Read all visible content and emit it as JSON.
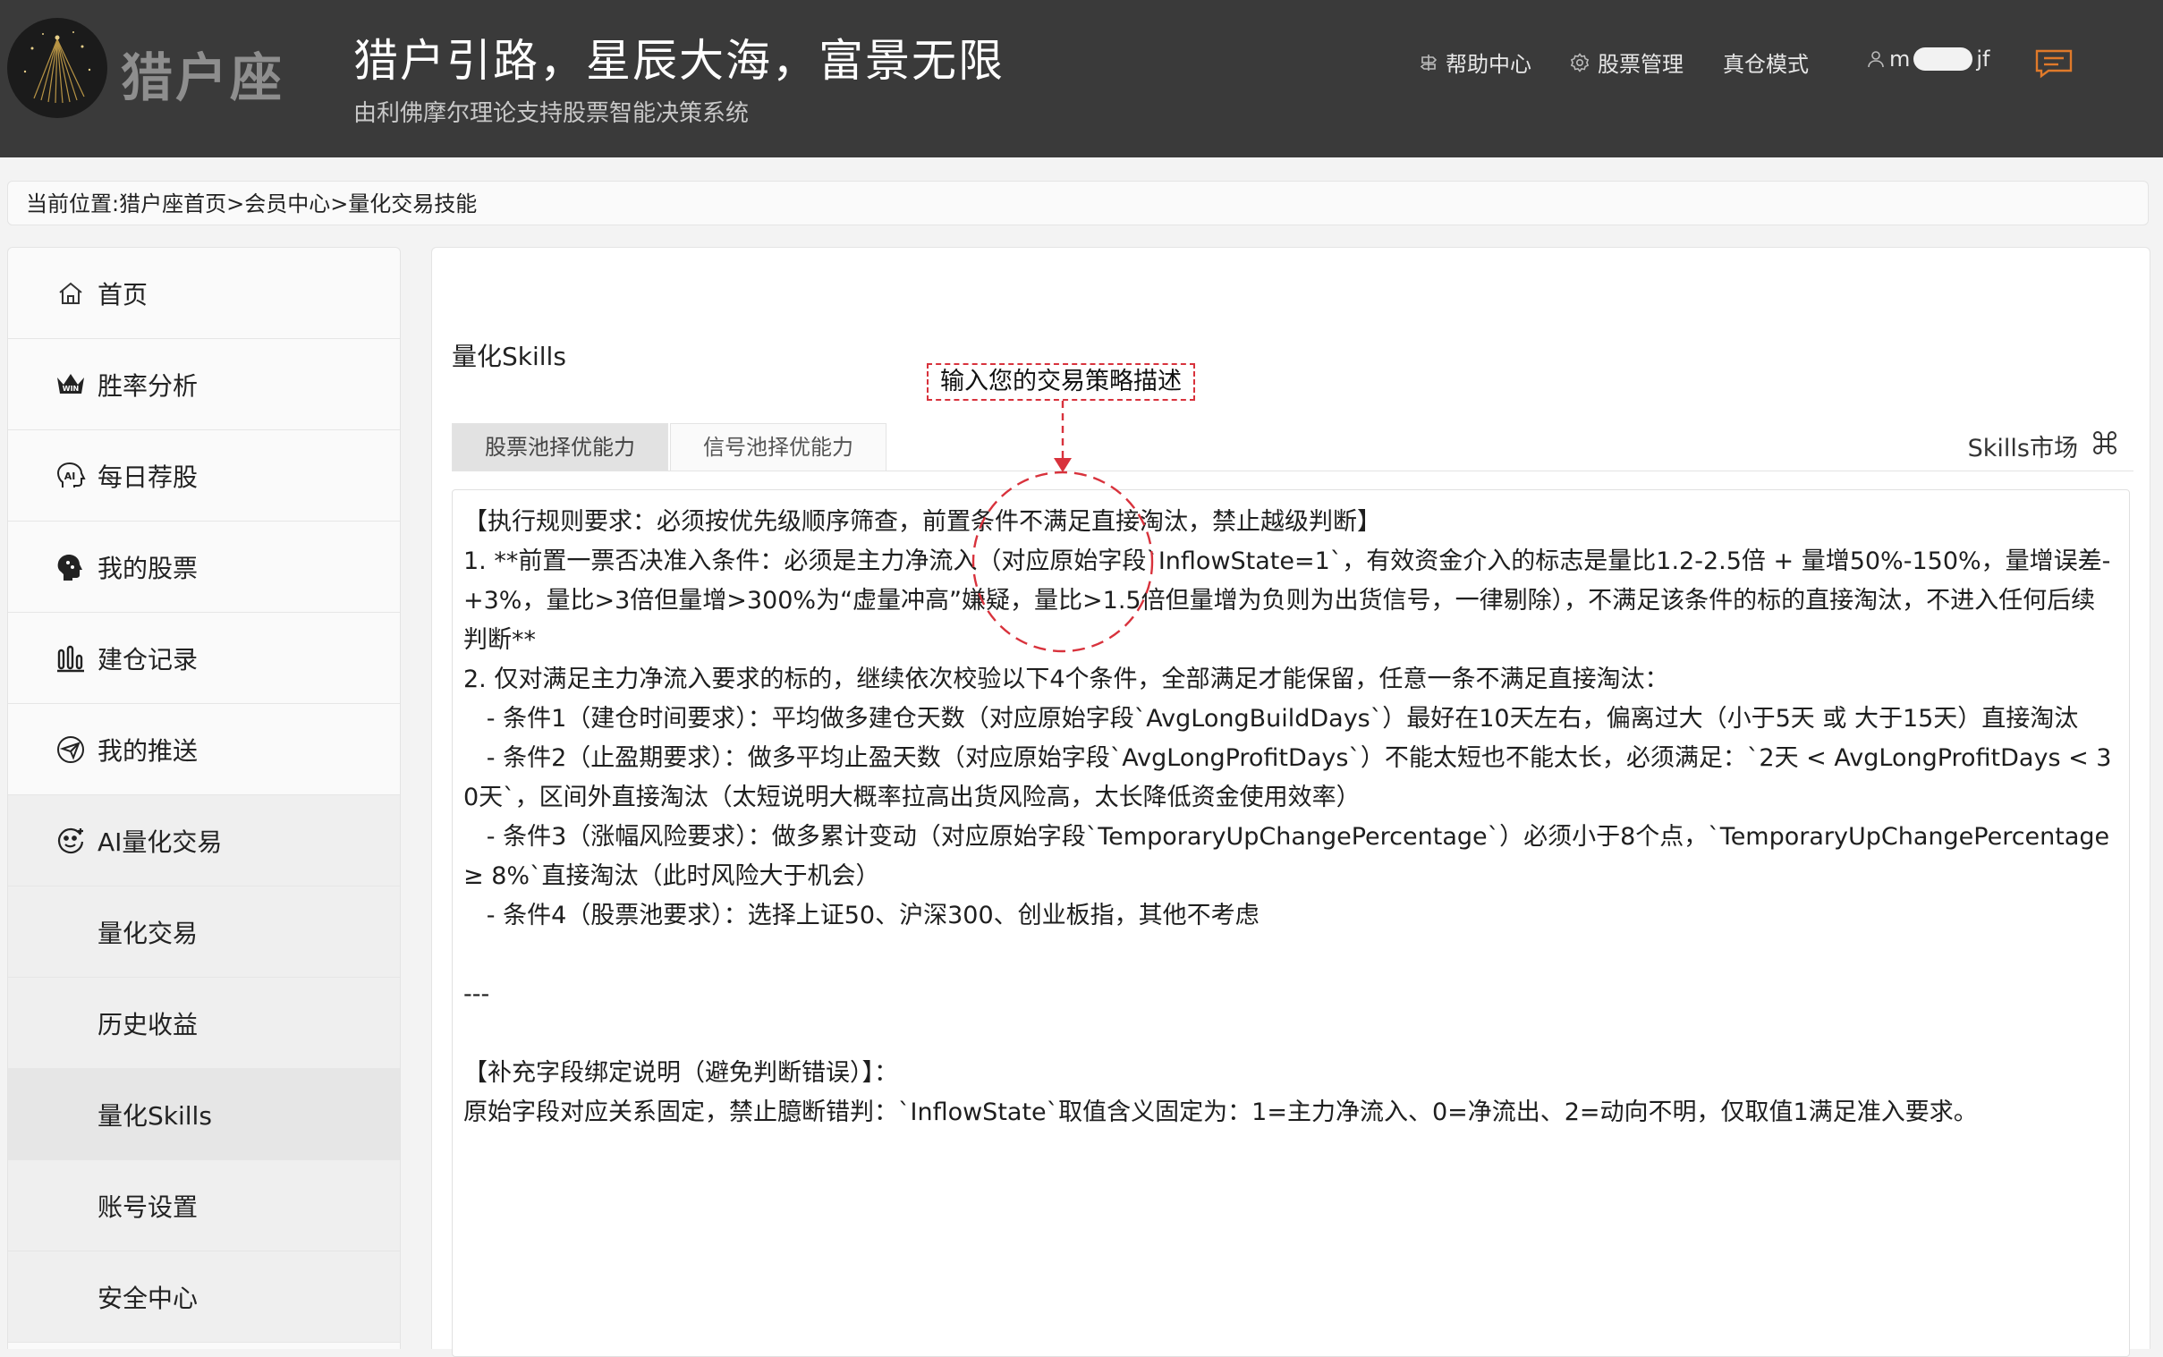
{
  "header": {
    "logo_text": "猎户座",
    "slogan": "猎户引路，星辰大海，富景无限",
    "subslogan": "由利佛摩尔理论支持股票智能决策系统",
    "nav": {
      "help": "帮助中心",
      "stock_manage": "股票管理",
      "real_mode": "真仓模式",
      "user_prefix": "m",
      "user_suffix": "jf"
    }
  },
  "breadcrumb": "当前位置:猎户座首页>会员中心>量化交易技能",
  "sidebar": {
    "items": [
      {
        "label": "首页",
        "icon": "home-icon"
      },
      {
        "label": "胜率分析",
        "icon": "crown-icon"
      },
      {
        "label": "每日荐股",
        "icon": "ai-head-icon"
      },
      {
        "label": "我的股票",
        "icon": "brain-icon"
      },
      {
        "label": "建仓记录",
        "icon": "bar-chart-icon"
      },
      {
        "label": "我的推送",
        "icon": "send-icon"
      },
      {
        "label": "AI量化交易",
        "icon": "ai-face-icon"
      },
      {
        "label": "量化交易"
      },
      {
        "label": "历史收益"
      },
      {
        "label": "量化Skills"
      },
      {
        "label": "账号设置"
      },
      {
        "label": "安全中心"
      }
    ]
  },
  "main": {
    "title": "量化Skills",
    "tabs": [
      "股票池择优能力",
      "信号池择优能力"
    ],
    "skills_market": "Skills市场",
    "strategy_text": "【执行规则要求：必须按优先级顺序筛查，前置条件不满足直接淘汰，禁止越级判断】\n1. **前置一票否决准入条件：必须是主力净流入（对应原始字段`InflowState=1`，有效资金介入的标志是量比1.2-2.5倍 + 量增50%-150%，量增误差-+3%，量比>3倍但量增>300%为“虚量冲高”嫌疑，量比>1.5倍但量增为负则为出货信号，一律剔除），不满足该条件的标的直接淘汰，不进入任何后续判断**\n2. 仅对满足主力净流入要求的标的，继续依次校验以下4个条件，全部满足才能保留，任意一条不满足直接淘汰：\n   - 条件1（建仓时间要求）：平均做多建仓天数（对应原始字段`AvgLongBuildDays`）最好在10天左右，偏离过大（小于5天 或 大于15天）直接淘汰\n   - 条件2（止盈期要求）：做多平均止盈天数（对应原始字段`AvgLongProfitDays`）不能太短也不能太长，必须满足：`2天 < AvgLongProfitDays < 30天`，区间外直接淘汰（太短说明大概率拉高出货风险高，太长降低资金使用效率）\n   - 条件3（涨幅风险要求）：做多累计变动（对应原始字段`TemporaryUpChangePercentage`）必须小于8个点，`TemporaryUpChangePercentage ≥ 8%`直接淘汰（此时风险大于机会）\n   - 条件4（股票池要求）：选择上证50、沪深300、创业板指，其他不考虑\n\n---\n\n【补充字段绑定说明（避免判断错误）】：\n原始字段对应关系固定，禁止臆断错判：`InflowState`取值含义固定为：1=主力净流入、0=净流出、2=动向不明，仅取值1满足准入要求。"
  },
  "annotation": {
    "label": "输入您的交易策略描述"
  },
  "colors": {
    "header_bg": "#3a3a3a",
    "annotation": "#d8323c",
    "message_icon": "#e07a2a"
  }
}
